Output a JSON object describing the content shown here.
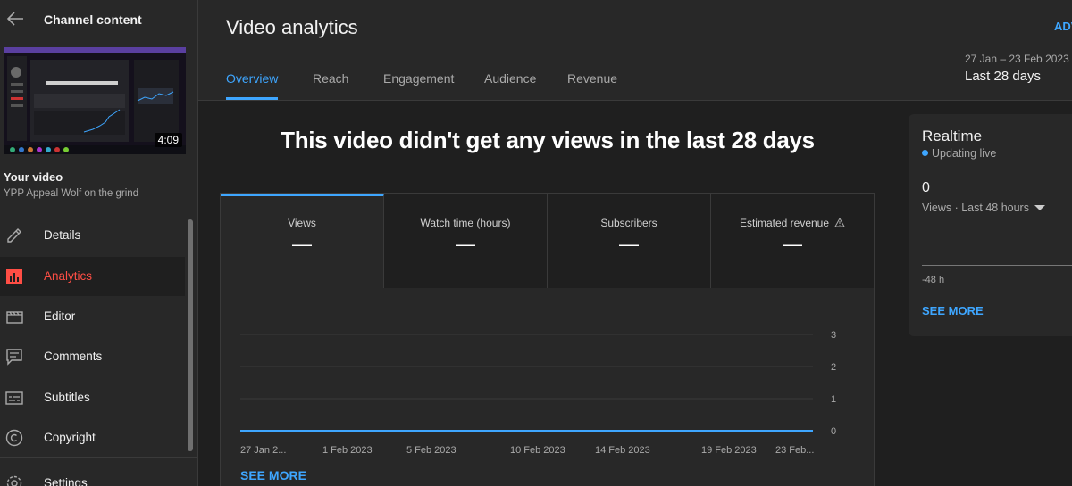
{
  "sidebar": {
    "title": "Channel content",
    "thumbnail_duration": "4:09",
    "your_video_label": "Your video",
    "video_title": "YPP Appeal Wolf on the grind",
    "items": [
      {
        "label": "Details",
        "icon": "pencil-icon",
        "active": false
      },
      {
        "label": "Analytics",
        "icon": "analytics-icon",
        "active": true
      },
      {
        "label": "Editor",
        "icon": "clapperboard-icon",
        "active": false
      },
      {
        "label": "Comments",
        "icon": "comment-icon",
        "active": false
      },
      {
        "label": "Subtitles",
        "icon": "subtitles-icon",
        "active": false
      },
      {
        "label": "Copyright",
        "icon": "copyright-icon",
        "active": false
      },
      {
        "label": "Settings",
        "icon": "gear-icon",
        "active": false
      }
    ]
  },
  "header": {
    "title": "Video analytics",
    "advanced_label": "ADV",
    "date_range": "27 Jan – 23 Feb 2023",
    "period_label": "Last 28 days",
    "tabs": [
      {
        "label": "Overview",
        "active": true
      },
      {
        "label": "Reach",
        "active": false
      },
      {
        "label": "Engagement",
        "active": false
      },
      {
        "label": "Audience",
        "active": false
      },
      {
        "label": "Revenue",
        "active": false
      }
    ]
  },
  "main": {
    "headline": "This video didn't get any views in the last 28 days",
    "metrics": [
      {
        "label": "Views",
        "value": "—",
        "active": true
      },
      {
        "label": "Watch time (hours)",
        "value": "—",
        "active": false
      },
      {
        "label": "Subscribers",
        "value": "—",
        "active": false
      },
      {
        "label": "Estimated revenue",
        "value": "—",
        "active": false,
        "warning": true
      }
    ],
    "see_more": "SEE MORE"
  },
  "chart_data": {
    "type": "line",
    "x_tick_labels": [
      "27 Jan 2...",
      "1 Feb 2023",
      "5 Feb 2023",
      "10 Feb 2023",
      "14 Feb 2023",
      "19 Feb 2023",
      "23 Feb..."
    ],
    "y_ticks": [
      "0",
      "1",
      "2",
      "3"
    ],
    "ylim": [
      0,
      3
    ],
    "series": [
      {
        "values": [
          0,
          0,
          0,
          0,
          0,
          0,
          0,
          0,
          0,
          0,
          0,
          0,
          0,
          0,
          0,
          0,
          0,
          0,
          0,
          0,
          0,
          0,
          0,
          0,
          0,
          0,
          0,
          0
        ],
        "color": "#3ea6ff"
      }
    ],
    "grid": true
  },
  "realtime": {
    "title": "Realtime",
    "status": "Updating live",
    "value": "0",
    "subtitle": "Views · Last 48 hours",
    "axis_label": "-48 h",
    "see_more": "SEE MORE"
  },
  "colors": {
    "accent": "#3ea6ff",
    "active_nav": "#ff4e45",
    "background": "#282828",
    "panel": "#1f1f1f"
  }
}
